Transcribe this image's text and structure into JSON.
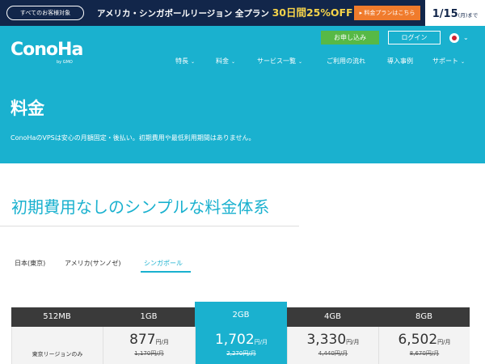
{
  "promo": {
    "pill": "すべてのお客様対象",
    "text_prefix": "アメリカ・シンガポールリージョン 全プラン",
    "highlight": "30日間25%OFF!!",
    "button": "料金プランはこちら",
    "date_big": "1/15",
    "date_small": "(月)まで"
  },
  "header": {
    "logo": "ConoHa",
    "logo_sub": "by GMO",
    "apply": "お申し込み",
    "login": "ログイン",
    "nav": [
      "特長",
      "料金",
      "サービス一覧",
      "ご利用の流れ",
      "導入事例",
      "サポート"
    ],
    "chevron": "⌄"
  },
  "hero": {
    "title": "料金",
    "subtitle": "ConoHaのVPSは安心の月額固定・後払い。初期費用や最低利用期間はありません。"
  },
  "section": {
    "title": "初期費用なしのシンプルな料金体系"
  },
  "tabs": {
    "items": [
      "日本(東京)",
      "アメリカ(サンノゼ)",
      "シンガポール"
    ],
    "active": 2
  },
  "plans": [
    {
      "name": "512MB",
      "note": "東京リージョンのみ"
    },
    {
      "name": "1GB",
      "price": "877",
      "unit": "円/月",
      "old": "1,170円/月"
    },
    {
      "name": "2GB",
      "price": "1,702",
      "unit": "円/月",
      "old": "2,270円/月"
    },
    {
      "name": "4GB",
      "price": "3,330",
      "unit": "円/月",
      "old": "4,440円/月"
    },
    {
      "name": "8GB",
      "price": "6,502",
      "unit": "円/月",
      "old": "8,670円/月"
    }
  ],
  "colors": {
    "brand": "#1ab1cf",
    "promo_bg": "#12264a",
    "promo_accent": "#f5d34a",
    "promo_button": "#f07b2c",
    "apply_green": "#57b946",
    "plan_head": "#3a3a3a"
  }
}
